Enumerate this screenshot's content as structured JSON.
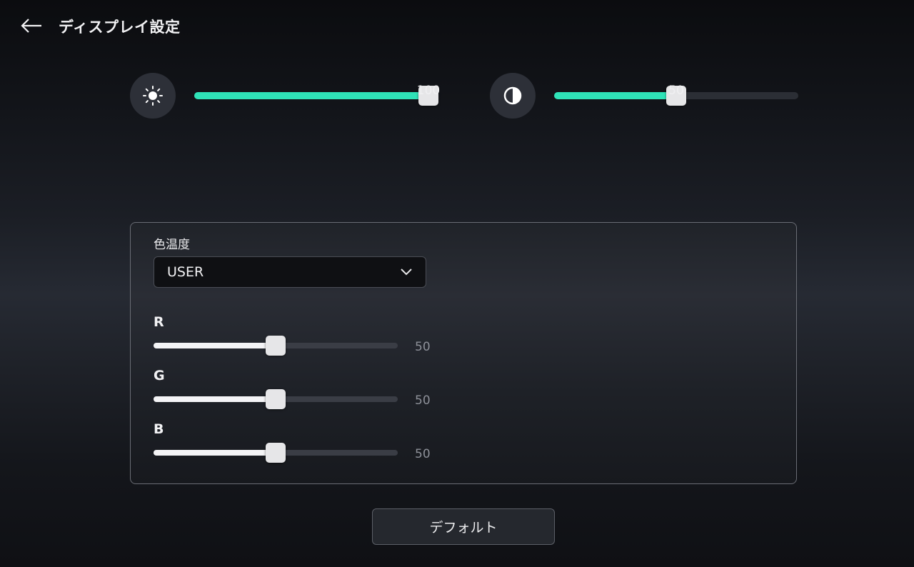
{
  "header": {
    "title": "ディスプレイ設定",
    "back_icon": "arrow-left-icon"
  },
  "brightness": {
    "icon": "sun-icon",
    "value": "100",
    "level": 100,
    "max": 100
  },
  "contrast": {
    "icon": "contrast-icon",
    "value": "50",
    "level": 50,
    "max": 100
  },
  "color_temperature": {
    "label": "色温度",
    "selected": "USER",
    "chevron_icon": "chevron-down-icon"
  },
  "rgb": [
    {
      "label": "R",
      "value": "50",
      "level": 50
    },
    {
      "label": "G",
      "value": "50",
      "level": 50
    },
    {
      "label": "B",
      "value": "50",
      "level": 50
    }
  ],
  "default_button": {
    "label": "デフォルト"
  },
  "colors": {
    "accent": "#2fe3b8",
    "track": "#2b2e35",
    "thumb": "#e6e6e8"
  }
}
